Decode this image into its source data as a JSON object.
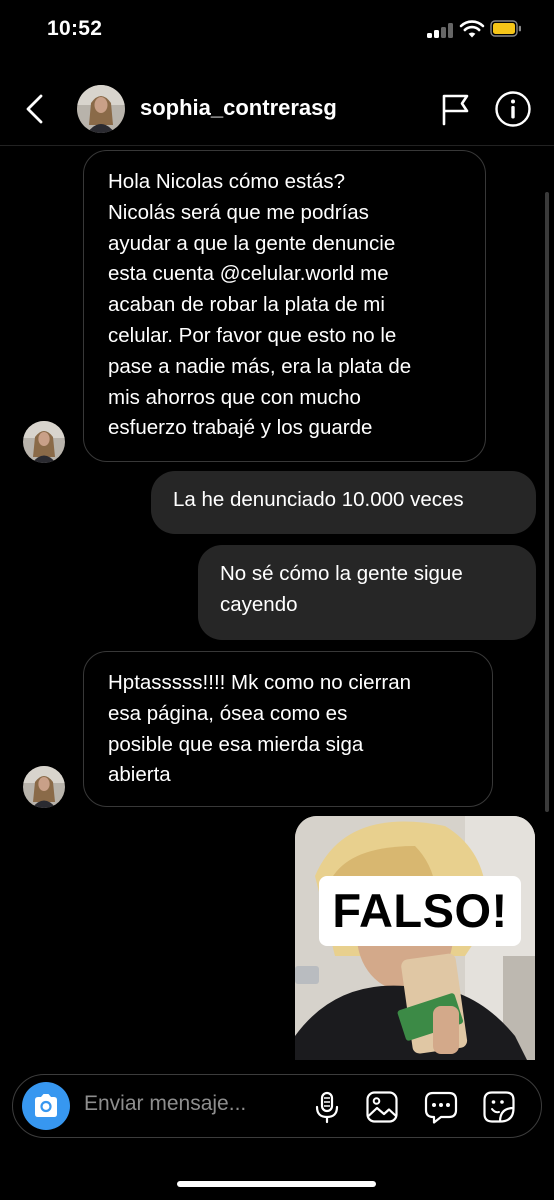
{
  "status_bar": {
    "time": "10:52",
    "signal_icon": "cellular-signal-icon",
    "wifi_icon": "wifi-icon",
    "battery_icon": "battery-icon",
    "battery_color": "#f5c518"
  },
  "header": {
    "username": "sophia_contrerasg",
    "back_icon": "chevron-left-icon",
    "flag_icon": "flag-icon",
    "info_icon": "info-icon"
  },
  "messages": [
    {
      "direction": "incoming",
      "text": "Hola Nicolas cómo estás?\nNicolás será que me podrías\nayudar a que la gente denuncie\nesta cuenta @celular.world me\nacaban de robar la plata de mi\ncelular. Por favor que esto no le\npase a nadie más, era la plata de\nmis ahorros que con mucho\nesfuerzo trabajé y los guarde"
    },
    {
      "direction": "outgoing",
      "text": "La he denunciado 10.000 veces"
    },
    {
      "direction": "outgoing",
      "text": "No sé cómo la gente sigue\ncayendo"
    },
    {
      "direction": "incoming",
      "text": "Hptasssss!!!! Mk como no cierran\nesa página, ósea como es\nposible que esa mierda siga\nabierta"
    },
    {
      "direction": "outgoing",
      "type": "image",
      "overlay_text": "FALSO!"
    }
  ],
  "composer": {
    "placeholder": "Enviar mensaje...",
    "camera_icon": "camera-icon",
    "microphone_icon": "microphone-icon",
    "gallery_icon": "gallery-icon",
    "chat_icon": "chat-bubble-icon",
    "sticker_icon": "sticker-icon",
    "accent_color": "#3797f0"
  }
}
